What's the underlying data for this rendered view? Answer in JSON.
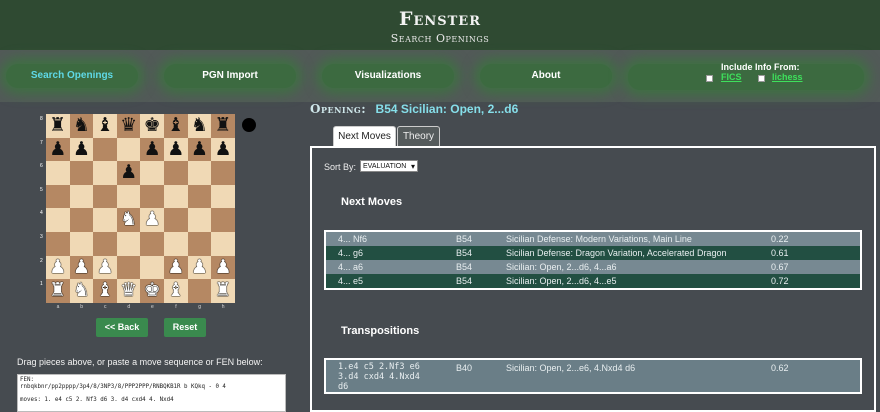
{
  "app": {
    "title": "Fenster",
    "tagline": "Search Openings"
  },
  "nav": {
    "items": [
      {
        "label": "Search Openings",
        "active": true
      },
      {
        "label": "PGN Import",
        "active": false
      },
      {
        "label": "Visualizations",
        "active": false
      },
      {
        "label": "About",
        "active": false
      }
    ],
    "include_title": "Include Info From:",
    "sources": [
      {
        "label": "FICS",
        "checked": false
      },
      {
        "label": "lichess",
        "checked": false
      }
    ]
  },
  "board": {
    "side_to_move": "black",
    "ranks": [
      "8",
      "7",
      "6",
      "5",
      "4",
      "3",
      "2",
      "1"
    ],
    "files": [
      "a",
      "b",
      "c",
      "d",
      "e",
      "f",
      "g",
      "h"
    ],
    "rows": [
      [
        "br",
        "bn",
        "bb",
        "bq",
        "bk",
        "bb",
        "bn",
        "br"
      ],
      [
        "bp",
        "bp",
        "",
        "",
        "bp",
        "bp",
        "bp",
        "bp"
      ],
      [
        "",
        "",
        "",
        "bp",
        "",
        "",
        "",
        ""
      ],
      [
        "",
        "",
        "",
        "",
        "",
        "",
        "",
        ""
      ],
      [
        "",
        "",
        "",
        "wn",
        "wp",
        "",
        "",
        ""
      ],
      [
        "",
        "",
        "",
        "",
        "",
        "",
        "",
        ""
      ],
      [
        "wp",
        "wp",
        "wp",
        "",
        "",
        "wp",
        "wp",
        "wp"
      ],
      [
        "wr",
        "wn",
        "wb",
        "wq",
        "wk",
        "wb",
        "",
        "wr"
      ]
    ]
  },
  "buttons": {
    "back": "<< Back",
    "reset": "Reset"
  },
  "input": {
    "instruction": "Drag pieces above, or paste a move sequence or FEN below:",
    "fen_label": "FEN:",
    "fen": "rnbqkbnr/pp2pppp/3p4/8/3NP3/8/PPP2PPP/RNBQKB1R b KQkq - 0 4",
    "moves": "moves: 1. e4 c5 2. Nf3 d6 3. d4 cxd4 4. Nxd4"
  },
  "opening": {
    "label": "Opening:",
    "name": "B54 Sicilian: Open, 2...d6"
  },
  "tabs": [
    {
      "label": "Next Moves",
      "active": true
    },
    {
      "label": "Theory",
      "active": false
    }
  ],
  "sort": {
    "label": "Sort By:",
    "value": "EVALUATION"
  },
  "next_moves": {
    "title": "Next Moves",
    "rows": [
      {
        "move": "4... Nf6",
        "eco": "B54",
        "name": "Sicilian Defense: Modern Variations, Main Line",
        "eval": "0.22"
      },
      {
        "move": "4... g6",
        "eco": "B54",
        "name": "Sicilian Defense: Dragon Variation, Accelerated Dragon",
        "eval": "0.61"
      },
      {
        "move": "4... a6",
        "eco": "B54",
        "name": "Sicilian: Open, 2...d6, 4...a6",
        "eval": "0.67"
      },
      {
        "move": "4... e5",
        "eco": "B54",
        "name": "Sicilian: Open, 2...d6, 4...e5",
        "eval": "0.72"
      }
    ]
  },
  "transpositions": {
    "title": "Transpositions",
    "rows": [
      {
        "moves": "1.e4 c5 2.Nf3 e6 3.d4 cxd4 4.Nxd4 d6",
        "eco": "B40",
        "name": "Sicilian: Open, 2...e6, 4.Nxd4 d6",
        "eval": "0.62"
      }
    ]
  },
  "colors": {
    "header": "#2f4a32",
    "nav_pill": "#3c6a40",
    "active_nav": "#5fd9e6",
    "light_square": "#f0d9b5",
    "dark_square": "#b58863",
    "row_light": "#778992",
    "row_dark": "#224f42"
  }
}
